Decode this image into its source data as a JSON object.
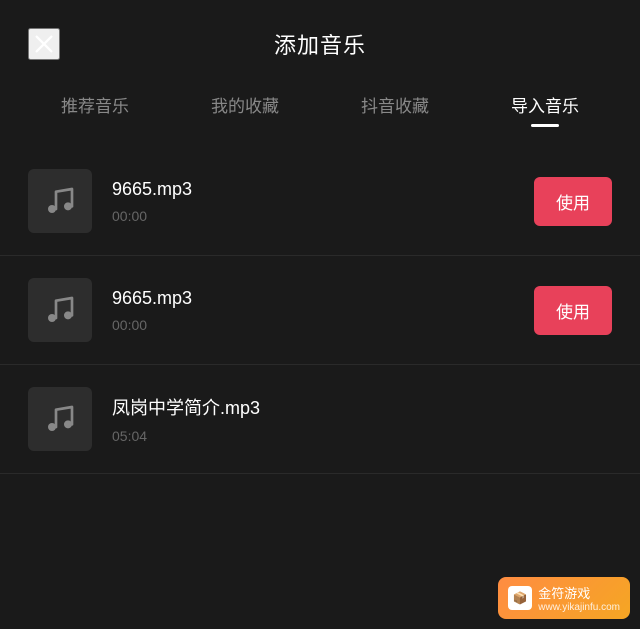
{
  "header": {
    "title": "添加音乐",
    "close_label": "×"
  },
  "tabs": [
    {
      "id": "recommend",
      "label": "推荐音乐",
      "active": false
    },
    {
      "id": "my-collection",
      "label": "我的收藏",
      "active": false
    },
    {
      "id": "douyin-collection",
      "label": "抖音收藏",
      "active": false
    },
    {
      "id": "import",
      "label": "导入音乐",
      "active": true
    }
  ],
  "music_list": [
    {
      "id": 1,
      "name": "9665.mp3",
      "duration": "00:00",
      "show_use": true,
      "use_label": "使用"
    },
    {
      "id": 2,
      "name": "9665.mp3",
      "duration": "00:00",
      "show_use": true,
      "use_label": "使用"
    },
    {
      "id": 3,
      "name": "凤岗中学简介.mp3",
      "duration": "05:04",
      "show_use": false
    }
  ],
  "watermark": {
    "site": "www.yikajinfu.com",
    "brand": "金符游戏",
    "icon_text": "🎮"
  }
}
